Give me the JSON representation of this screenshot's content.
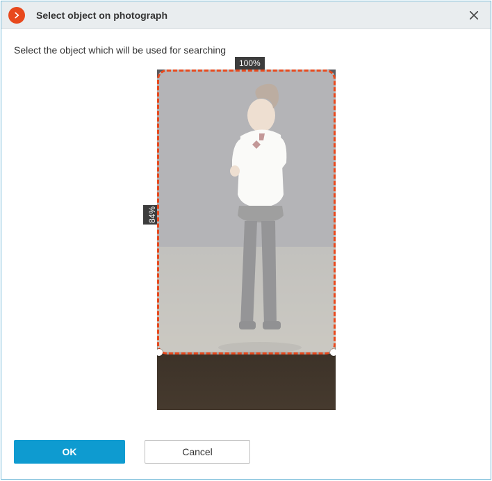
{
  "dialog": {
    "title": "Select object on photograph",
    "instruction": "Select the object which will be used for searching"
  },
  "selection": {
    "width_pct": "100%",
    "height_pct": "84%"
  },
  "buttons": {
    "ok": "OK",
    "cancel": "Cancel"
  },
  "icons": {
    "app": "chevron-right-circle",
    "close": "close"
  }
}
